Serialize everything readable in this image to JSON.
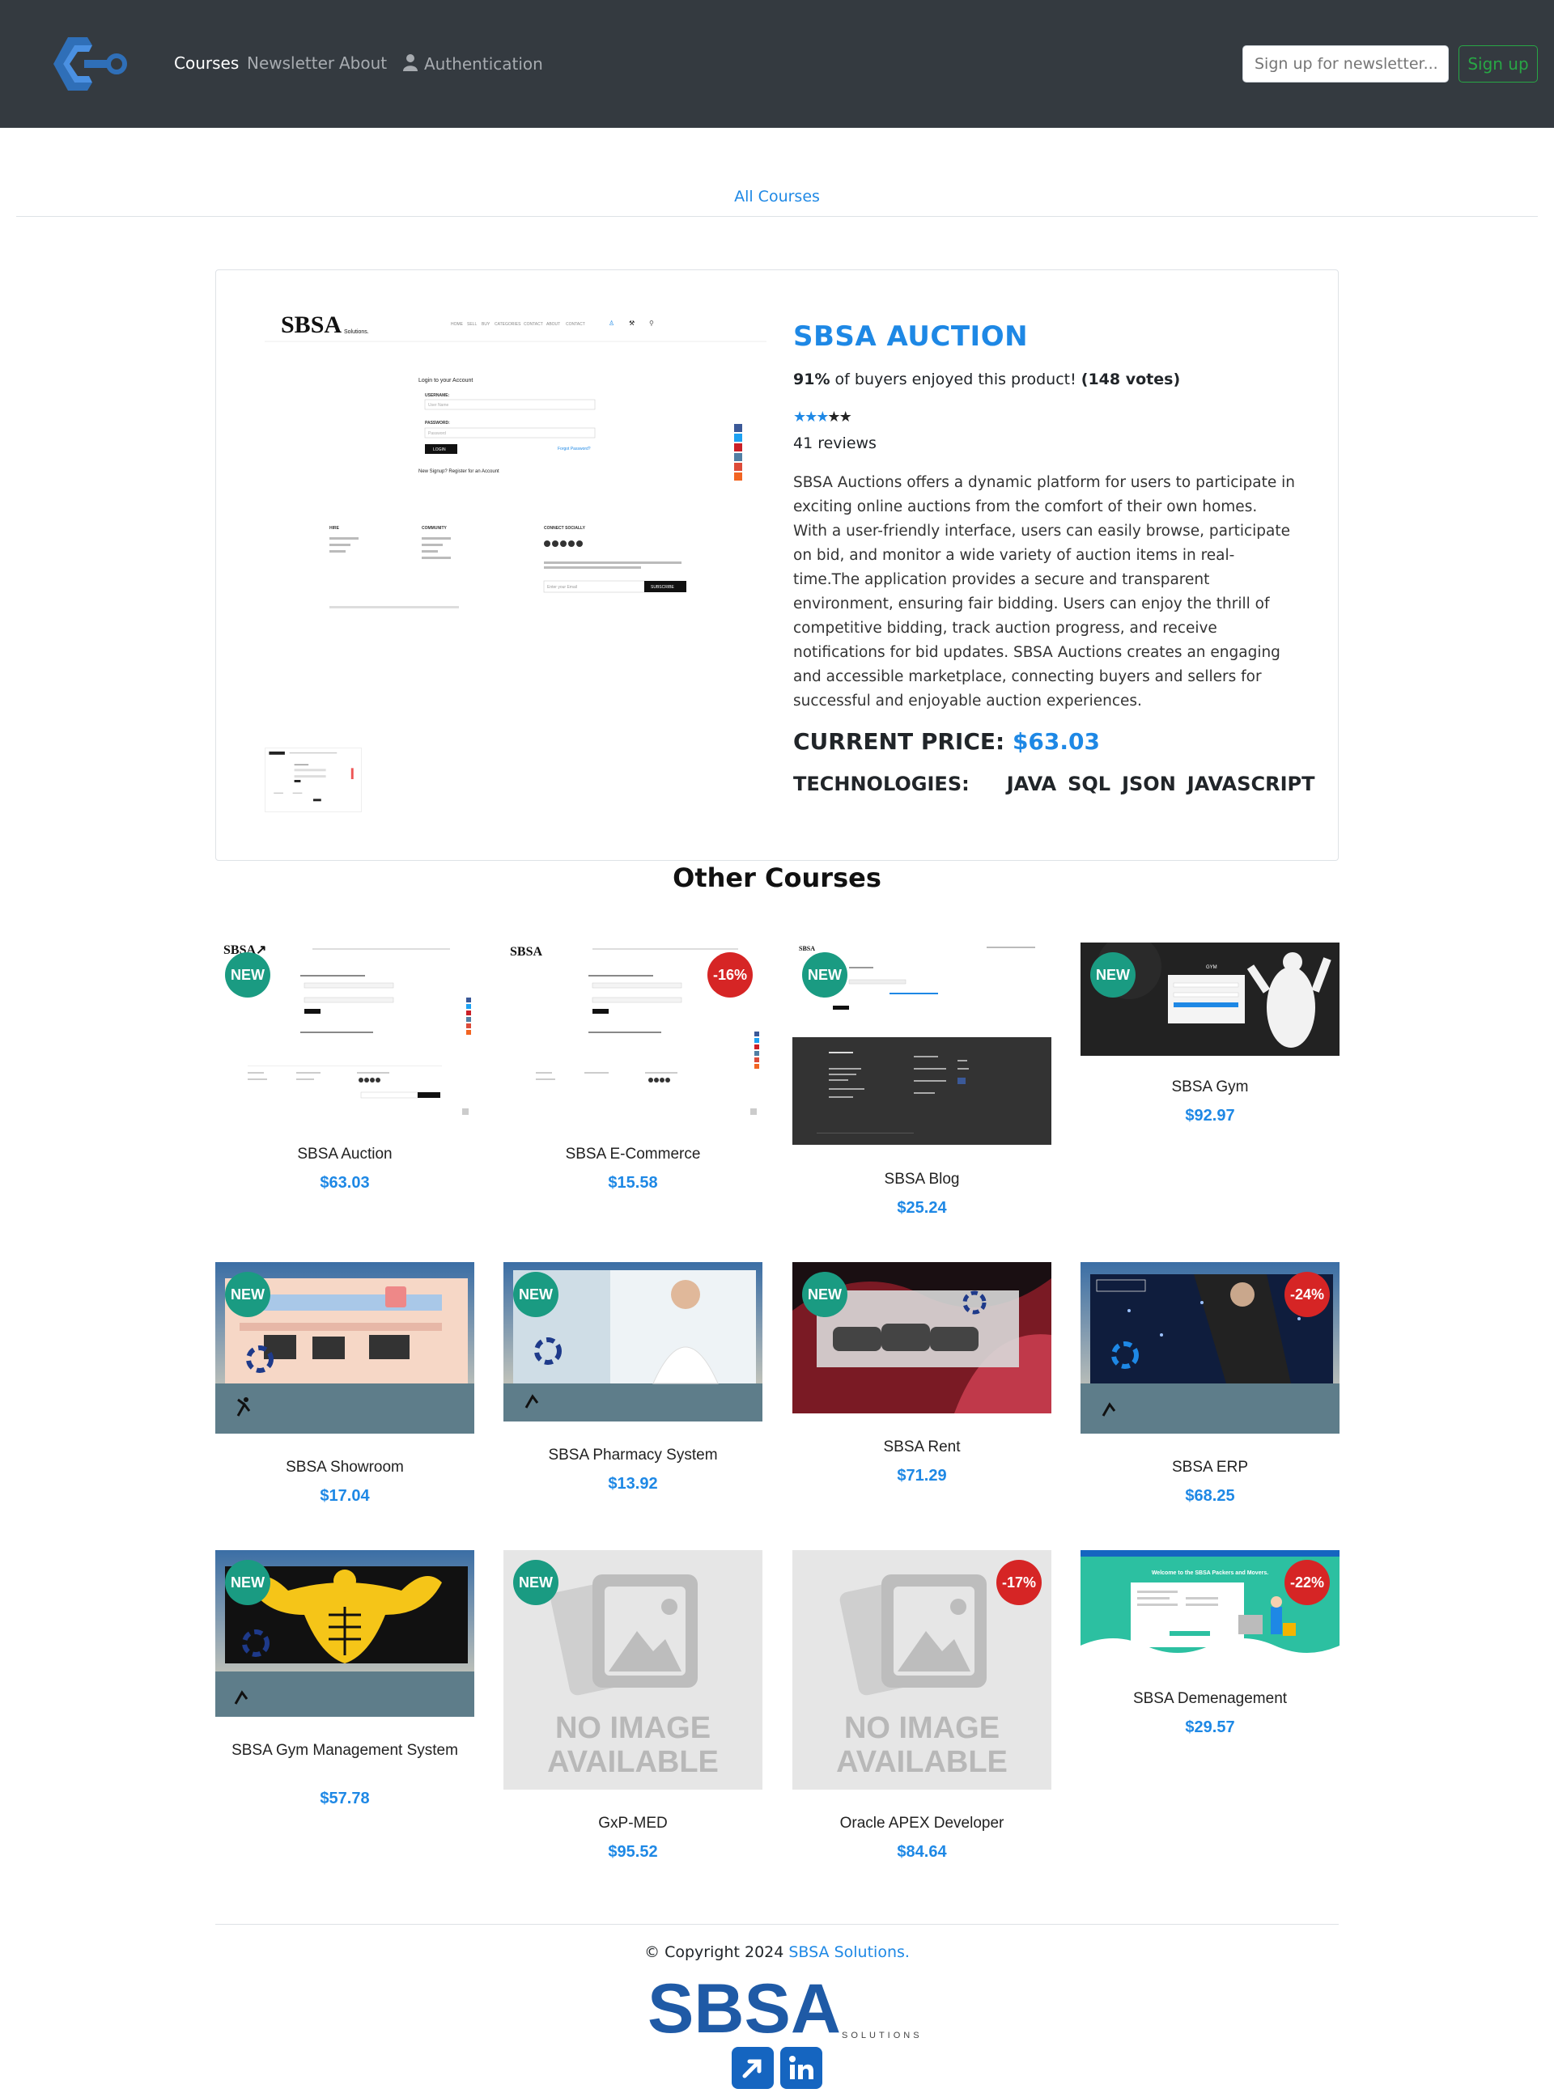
{
  "nav": {
    "links": [
      "Courses",
      "Newsletter",
      "About",
      "Authentication"
    ],
    "newsletter_placeholder": "Sign up for newsletter...",
    "signup_label": "Sign up"
  },
  "all_courses_link": "All Courses",
  "product": {
    "title": "SBSA AUCTION",
    "buyers_pct": "91%",
    "buyers_text": " of buyers enjoyed this product! ",
    "votes": "(148 votes)",
    "rating": 4,
    "reviews": "41 reviews",
    "description": "SBSA Auctions offers a dynamic platform for users to participate in exciting online auctions from the comfort of their own homes. With a user-friendly interface, users can easily browse, participate on bid, and monitor a wide variety of auction items in real-time.The application provides a secure and transparent environment, ensuring fair bidding. Users can enjoy the thrill of competitive bidding, track auction progress, and receive notifications for bid updates. SBSA Auctions creates an engaging and accessible marketplace, connecting buyers and sellers for successful and enjoyable auction experiences.",
    "price_label": "CURRENT PRICE: ",
    "price": "$63.03",
    "tech_label": "TECHNOLOGIES:",
    "technologies": [
      "JAVA",
      "SQL",
      "JSON",
      "JAVASCRIPT"
    ],
    "screenshot": {
      "brand": "SBSA",
      "brand_sub": "Solutions.",
      "menu": [
        "HOME",
        "SELL",
        "BUY",
        "CATEGORIES",
        "CONTACT",
        "ABOUT",
        "CONTACT"
      ],
      "login_title": "Login to your Account",
      "username_label": "USERNAME:",
      "username_ph": "User Name",
      "password_label": "PASSWORD:",
      "password_ph": "Password",
      "login_btn": "LOGIN",
      "forgot": "Forgot Password?",
      "signup_note": "New Signup? Register for an Account",
      "footer_cols": [
        "HIRE",
        "COMMUNITY",
        "CONNECT SOCIALLY"
      ],
      "subscribe_ph": "Enter your Email",
      "subscribe_btn": "SUBSCRIBE"
    }
  },
  "other_title": "Other Courses",
  "courses": [
    {
      "name": "SBSA Auction",
      "price": "$63.03",
      "badge": "NEW",
      "badge_type": "new"
    },
    {
      "name": "SBSA E-Commerce",
      "price": "$15.58",
      "badge": "-16%",
      "badge_type": "sale"
    },
    {
      "name": "SBSA Blog",
      "price": "$25.24",
      "badge": "NEW",
      "badge_type": "new"
    },
    {
      "name": "SBSA Gym",
      "price": "$92.97",
      "badge": "NEW",
      "badge_type": "new"
    },
    {
      "name": "SBSA Showroom",
      "price": "$17.04",
      "badge": "NEW",
      "badge_type": "new"
    },
    {
      "name": "SBSA Pharmacy System",
      "price": "$13.92",
      "badge": "NEW",
      "badge_type": "new"
    },
    {
      "name": "SBSA Rent",
      "price": "$71.29",
      "badge": "NEW",
      "badge_type": "new"
    },
    {
      "name": "SBSA ERP",
      "price": "$68.25",
      "badge": "-24%",
      "badge_type": "sale"
    },
    {
      "name": "SBSA Gym Management System",
      "price": "$57.78",
      "badge": "NEW",
      "badge_type": "new"
    },
    {
      "name": "GxP-MED",
      "price": "$95.52",
      "badge": "NEW",
      "badge_type": "new",
      "no_image": "NO IMAGE AVAILABLE"
    },
    {
      "name": "Oracle APEX Developer",
      "price": "$84.64",
      "badge": "-17%",
      "badge_type": "sale",
      "no_image": "NO IMAGE AVAILABLE"
    },
    {
      "name": "SBSA Demenagement",
      "price": "$29.57",
      "badge": "-22%",
      "badge_type": "sale",
      "banner_text": "Welcome to the SBSA Packers and Movers."
    }
  ],
  "footer": {
    "copyright": "© Copyright 2024 ",
    "brand": "SBSA Solutions.",
    "logo_text": "SBSA",
    "logo_sub": "SOLUTIONS",
    "icons": [
      "external-link-icon",
      "linkedin-icon"
    ]
  },
  "colors": {
    "navbar": "#343a40",
    "accent": "#1e88e5",
    "new_badge": "#1a9b82",
    "sale_badge": "#d62525",
    "signup": "#28a745"
  }
}
